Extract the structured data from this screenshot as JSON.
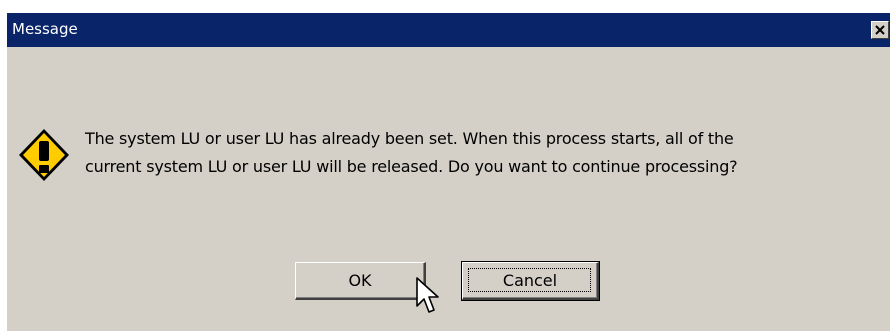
{
  "window": {
    "title": "Message",
    "close_glyph": "✕"
  },
  "message": {
    "line1": "The system LU or user LU has already been set. When this process starts, all of the",
    "line2": "current system LU or user LU will be released. Do you want to continue processing?"
  },
  "buttons": {
    "ok_label": "OK",
    "cancel_label": "Cancel"
  },
  "icons": {
    "warning": "warning-icon",
    "close": "close-icon",
    "cursor": "mouse-pointer-icon"
  },
  "colors": {
    "title_bar": "#0a246a",
    "dialog_bg": "#d4d0c8",
    "warning_fill": "#ffcc00"
  }
}
